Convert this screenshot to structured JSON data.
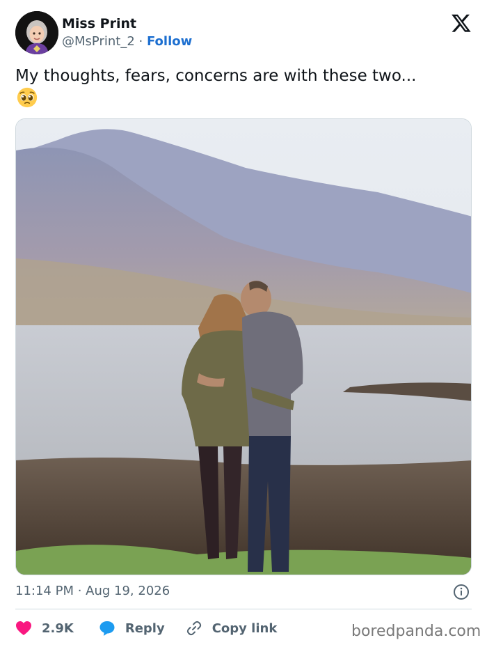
{
  "author": {
    "name": "Miss Print",
    "handle": "@MsPrint_2",
    "separator": "·",
    "follow_label": "Follow"
  },
  "tweet": {
    "text": "My thoughts, fears, concerns are with these two...",
    "emoji": "pleading-face-emoji"
  },
  "media": {
    "alt_hint": "photo-couple-by-lake"
  },
  "meta": {
    "timestamp": "11:14 PM · Aug 19, 2026"
  },
  "actions": {
    "likes": "2.9K",
    "reply_label": "Reply",
    "copy_label": "Copy link"
  },
  "watermark": "boredpanda.com",
  "colors": {
    "like": "#f91880",
    "reply": "#1d9bf0",
    "link": "#1d6fd0",
    "muted": "#536471"
  }
}
